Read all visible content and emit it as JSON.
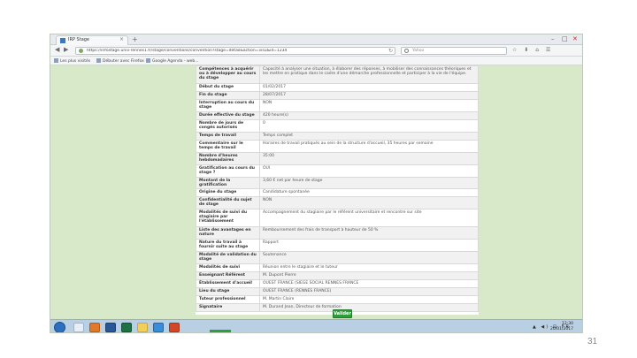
{
  "browser": {
    "tab_title": "IRP Stage",
    "tab_close": "×",
    "new_tab": "+",
    "url": "https://infostage.univ-rennes1.fr/stage/conventions/convention?stage=detail&action=visu&id=1234",
    "search_placeholder": "Yahoo",
    "back": "◀",
    "forward": "▶",
    "reload": "↻",
    "toolbar_icons": "☆ ⬇ ⌂ ☰",
    "window_controls": [
      "–",
      "□",
      "✕"
    ]
  },
  "bookmarks": [
    "Les plus visités",
    "Débuter avec Firefox",
    "Google Agenda - web..."
  ],
  "details": [
    {
      "label": "Compétences à acquérir ou à développer au cours du stage",
      "value": "Capacité à analyser une situation, à élaborer des réponses, à mobiliser des connaissances théoriques et les mettre en pratique dans le cadre d'une démarche professionnelle et participer à la vie de l'équipe.",
      "rowh": "h3"
    },
    {
      "label": "Début du stage",
      "value": "01/02/2017",
      "rowh": "h1"
    },
    {
      "label": "Fin du stage",
      "value": "28/07/2017",
      "rowh": "h1"
    },
    {
      "label": "Interruption au cours du stage",
      "value": "NON",
      "rowh": "h2"
    },
    {
      "label": "Durée effective du stage",
      "value": "420 heure(s)",
      "rowh": "h1"
    },
    {
      "label": "Nombre de jours de congés autorisés",
      "value": "0",
      "rowh": "h2"
    },
    {
      "label": "Temps de travail",
      "value": "Temps complet",
      "rowh": "h1"
    },
    {
      "label": "Commentaire sur le temps de travail",
      "value": "Horaires de travail pratiqués au sein de la structure d'accueil, 35 heures par semaine",
      "rowh": "h2"
    },
    {
      "label": "Nombre d'heures hebdomadaires",
      "value": "35:00",
      "rowh": "h2"
    },
    {
      "label": "Gratification au cours du stage ?",
      "value": "OUI",
      "rowh": "h2"
    },
    {
      "label": "Montant de la gratification",
      "value": "3,60 € net par heure de stage",
      "rowh": "h1"
    },
    {
      "label": "Origine du stage",
      "value": "Candidature spontanée",
      "rowh": "h1"
    },
    {
      "label": "Confidentialité du sujet de stage",
      "value": "NON",
      "rowh": "h2"
    },
    {
      "label": "Modalités de suivi du stagiaire par l'établissement",
      "value": "Accompagnement du stagiaire par le référent universitaire et rencontre sur site",
      "rowh": "h3"
    },
    {
      "label": "Liste des avantages en nature",
      "value": "Remboursement des frais de transport à hauteur de 50 %",
      "rowh": "h2"
    },
    {
      "label": "Nature du travail à fournir suite au stage",
      "value": "Rapport",
      "rowh": "h2"
    },
    {
      "label": "Modalité de validation du stage",
      "value": "Soutenance",
      "rowh": "h2"
    },
    {
      "label": "Modalités de suivi",
      "value": "Réunion entre le stagiaire et le tuteur",
      "rowh": "h1"
    },
    {
      "label": "Enseignant Référent",
      "value": "M. Dupont Pierre",
      "rowh": "h1"
    },
    {
      "label": "Établissement d'accueil",
      "value": "OUEST FRANCE (SIEGE SOCIAL RENNES FRANCE",
      "rowh": "h1"
    },
    {
      "label": "Lieu du stage",
      "value": "OUEST FRANCE (RENNES FRANCE)",
      "rowh": "h1"
    },
    {
      "label": "Tuteur professionnel",
      "value": "M. Martin Claire",
      "rowh": "h1"
    },
    {
      "label": "Signataire",
      "value": "M. Durand Jean, Directeur de formation",
      "rowh": "h1"
    }
  ],
  "actions": {
    "validate_label": "Valider"
  },
  "taskbar": {
    "tray": "▲ ◀) ⊡ FR",
    "time": "12:30",
    "date": "20/01/2017"
  },
  "slide": {
    "page_number": "31"
  },
  "colors": {
    "page_bg": "#d7e9c8",
    "validate": "#2f9d3a",
    "taskbar": "#b9cfe3"
  }
}
